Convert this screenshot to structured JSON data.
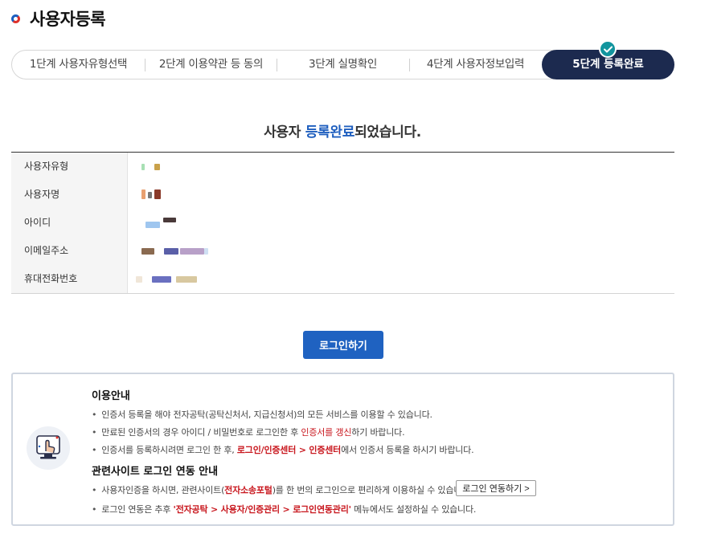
{
  "page": {
    "title": "사용자등록"
  },
  "stepper": {
    "steps": [
      {
        "label": "1단계 사용자유형선택"
      },
      {
        "label": "2단계 이용약관 등 동의"
      },
      {
        "label": "3단계 실명확인"
      },
      {
        "label": "4단계 사용자정보입력"
      },
      {
        "label": "5단계 등록완료"
      }
    ],
    "active_index": 4
  },
  "complete": {
    "prefix": "사용자 ",
    "highlight": "등록완료",
    "suffix": "되었습니다."
  },
  "info": {
    "rows": [
      {
        "label": "사용자유형"
      },
      {
        "label": "사용자명"
      },
      {
        "label": "아이디"
      },
      {
        "label": "이메일주소"
      },
      {
        "label": "휴대전화번호"
      }
    ]
  },
  "login_button": "로그인하기",
  "guide": {
    "usage_title": "이용안내",
    "usage_1": "인증서 등록을 해야 전자공탁(공탁신처서, 지급신청서)의 모든 서비스를 이용할 수 있습니다.",
    "usage_2_a": "만료된 인증서의 경우 아이디 / 비밀번호로 로그인한 후 ",
    "usage_2_red": "인증서를 갱신",
    "usage_2_b": "하기 바랍니다.",
    "usage_3_a": "인증서를 등록하시려면 로그인 한 후, ",
    "usage_3_red": "로그인/인증센터 > 인증센터",
    "usage_3_b": "에서 인증서 등록을 하시기 바랍니다.",
    "related_title": "관련사이트 로그인 연동 안내",
    "related_1_a": "사용자인증을 하시면, 관련사이트(",
    "related_1_red": "전자소송포털",
    "related_1_b": ")를 한 번의 로그인으로 편리하게 이용하실 수 있습니다.",
    "link_button": "로그인 연동하기 >",
    "related_2_a": "로그인 연동은 추후 ",
    "related_2_red": "'전자공탁 > 사용자/인증관리 >  로그인연동관리'",
    "related_2_b": " 메뉴에서도 설정하실 수 있습니다."
  },
  "colors": {
    "primary": "#1f62c1",
    "active_step": "#1c2a4f",
    "check_badge": "#12959e",
    "emphasis_red": "#c8161d"
  }
}
